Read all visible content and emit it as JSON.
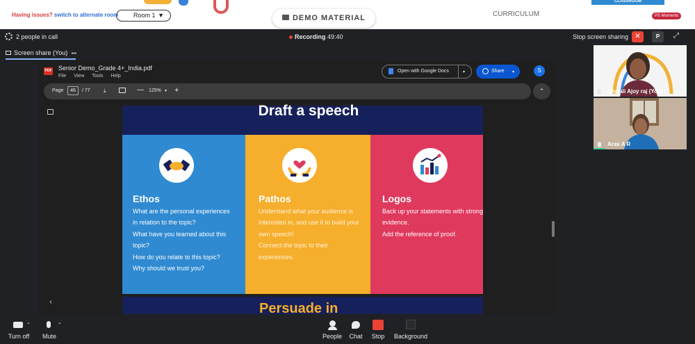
{
  "topbar": {
    "issue_prefix": "Having issues?",
    "issue_link": "switch to alternate room",
    "room": "Room 1",
    "room_caret": "▼",
    "demo_material": "DEMO MATERIAL",
    "curriculum": "CURRICULUM",
    "class_tab": "CLASSROOM",
    "moments": "PS Moments"
  },
  "meetbar": {
    "people": "2 people in call",
    "recording_label": "Recording",
    "recording_time": "49:40",
    "stop_sharing": "Stop screen sharing",
    "p_button": "P",
    "stop_x": "✕",
    "expand": "⤢"
  },
  "share_tab": {
    "label": "Screen share (You)",
    "more": "•••"
  },
  "pdf": {
    "logo": "PDF",
    "title": "Senior Demo_Grade 4+_India.pdf",
    "menu": [
      "File",
      "View",
      "Tools",
      "Help"
    ],
    "open_docs": "Open with Google Docs",
    "share": "Share",
    "avatar": "S",
    "page_label": "Page",
    "page": "46",
    "total": "/   77",
    "zoom": "125%",
    "minus": "—",
    "plus": "+",
    "caret": "▾",
    "download": "⤓",
    "collapse": "⌃",
    "left_arrow": "‹"
  },
  "slide": {
    "title": "Draft a speech",
    "panels": [
      {
        "heading": "Ethos",
        "lines": [
          "What are the personal experiences",
          "in relation to the topic?",
          "What have you learned about this",
          "topic?",
          "How do you relate to this topic?",
          "Why should we trust you?"
        ]
      },
      {
        "heading": "Pathos",
        "lines": [
          "Understand what your audience is",
          "interested in, and use it to build your",
          "own speech!",
          "Connect the topic to their",
          "experiences."
        ]
      },
      {
        "heading": "Logos",
        "lines": [
          "Back up your statements with strong",
          "evidence.",
          "Add the reference of proof."
        ]
      }
    ],
    "next_title": "Persuade in"
  },
  "participants": [
    {
      "name": "Shafali Ajoy raj (You)"
    },
    {
      "name": "Arav A R"
    }
  ],
  "controls": {
    "camera": "Turn off",
    "mic": "Mute",
    "people": "People",
    "chat": "Chat",
    "stop": "Stop",
    "background": "Background"
  },
  "colors": {
    "ethos": "#2f8ad1",
    "pathos": "#f6ae2d",
    "logos": "#e0395e",
    "slide_navy": "#16205a",
    "stop_red": "#ea4335"
  }
}
